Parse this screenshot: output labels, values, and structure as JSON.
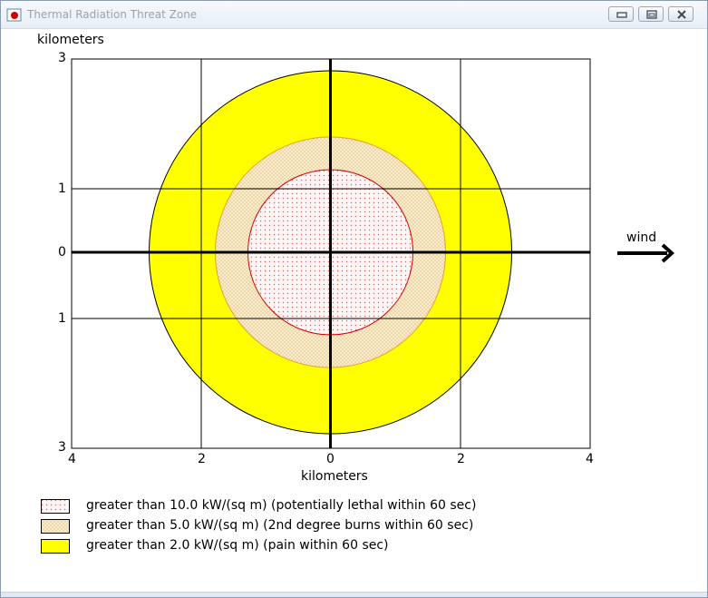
{
  "window": {
    "title": "Thermal Radiation Threat Zone",
    "controls": {
      "minimize": "minimize",
      "maximize": "maximize",
      "close": "close"
    }
  },
  "plot": {
    "ylabel": "kilometers",
    "xlabel": "kilometers",
    "y_ticks": [
      "3",
      "1",
      "0",
      "1",
      "3"
    ],
    "x_ticks": [
      "4",
      "2",
      "0",
      "2",
      "4"
    ],
    "wind_label": "wind",
    "zones_km_radius": [
      {
        "id": "pain",
        "radius_km": 2.8,
        "fill": "#ffff00",
        "stroke": "#000000"
      },
      {
        "id": "burns",
        "radius_km": 1.78,
        "fill": "#f3e2b7",
        "stroke": "#e2a030"
      },
      {
        "id": "lethal",
        "radius_km": 1.27,
        "fill": "#fff0f0",
        "stroke": "#d40000"
      }
    ]
  },
  "legend": [
    {
      "label": "greater than 10.0 kW/(sq m) (potentially lethal within 60 sec)",
      "color": "#d40000"
    },
    {
      "label": "greater than 5.0 kW/(sq m) (2nd degree burns within 60 sec)",
      "color": "#e2a030"
    },
    {
      "label": "greater than 2.0 kW/(sq m) (pain within 60 sec)",
      "color": "#ffff00"
    }
  ],
  "colors": {
    "accent": "#000000",
    "lethal": "#d40000",
    "burns": "#e2a030",
    "pain": "#ffff00"
  }
}
